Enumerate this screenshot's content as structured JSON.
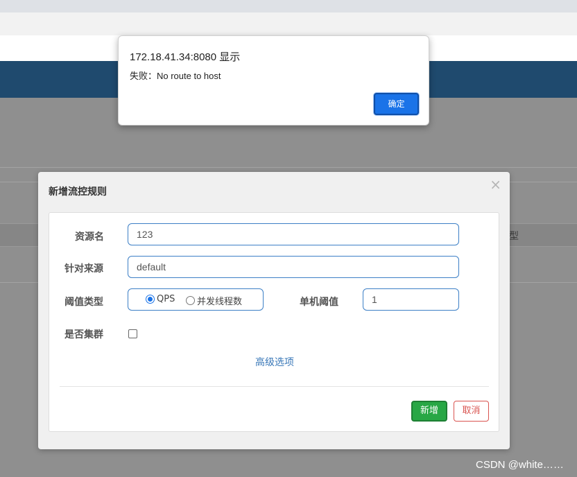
{
  "background": {
    "table_header_partial": "型"
  },
  "modal": {
    "title": "新增流控规则",
    "close_symbol": "×",
    "form": {
      "resource_label": "资源名",
      "resource_value": "123",
      "source_label": "针对来源",
      "source_value": "default",
      "threshold_type_label": "阈值类型",
      "threshold_options": [
        "QPS",
        "并发线程数"
      ],
      "threshold_selected": "QPS",
      "single_threshold_label": "单机阈值",
      "single_threshold_value": "1",
      "cluster_label": "是否集群",
      "cluster_checked": false,
      "advanced_link": "高级选项"
    },
    "buttons": {
      "add": "新增",
      "cancel": "取消"
    }
  },
  "alert": {
    "title": "172.18.41.34:8080 显示",
    "message": "失败：No route to host",
    "ok": "确定"
  },
  "watermark": "CSDN @white……",
  "colors": {
    "header": "#1f4a6e",
    "primary": "#1a73e8",
    "success": "#28a745",
    "danger": "#d9534f",
    "input_border": "#3c7fc6"
  }
}
